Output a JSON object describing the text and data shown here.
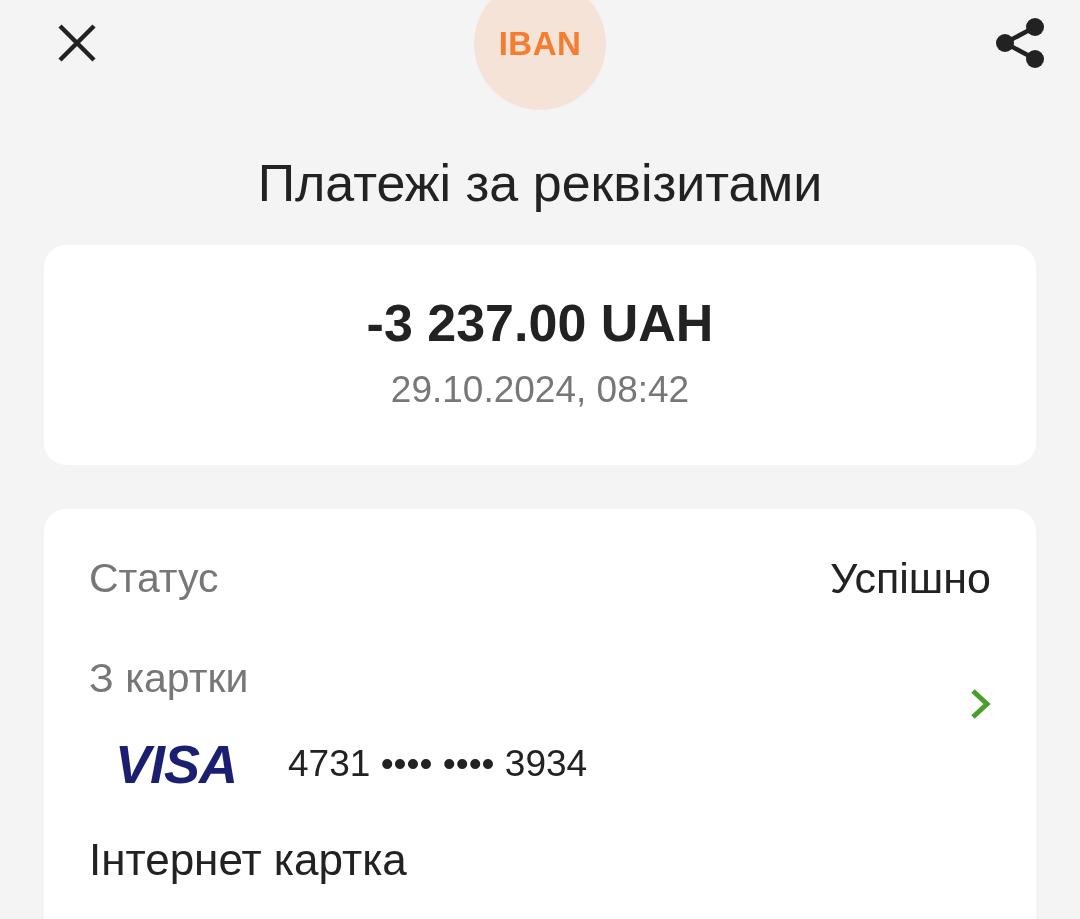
{
  "badge": {
    "text": "IBAN"
  },
  "title": "Платежі за реквізитами",
  "summary": {
    "amount": "-3 237.00 UAH",
    "datetime": "29.10.2024, 08:42"
  },
  "details": {
    "status": {
      "label": "Статус",
      "value": "Успішно"
    },
    "source": {
      "label": "З картки",
      "card_brand": "VISA",
      "card_number": "4731 •••• •••• 3934",
      "card_name": "Інтернет картка"
    }
  }
}
